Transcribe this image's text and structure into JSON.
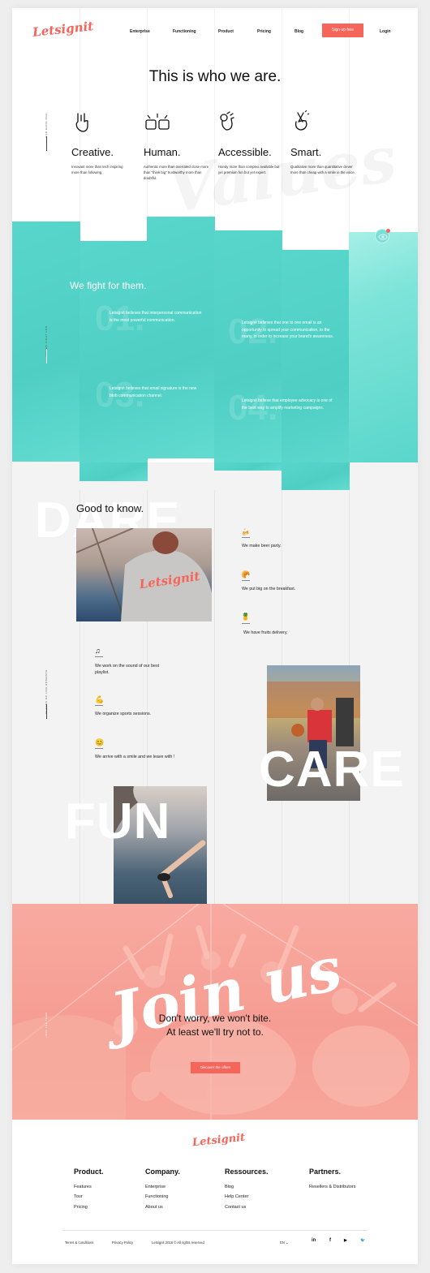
{
  "header": {
    "logo": "Letsignit",
    "nav": [
      "Enterprise",
      "Functioning",
      "Product",
      "Pricing",
      "Blog"
    ],
    "signup": "Sign up free",
    "login": "Login"
  },
  "values": {
    "title": "This is who we are.",
    "side_label": "OUR GANG DNA",
    "watermark": "Values",
    "items": [
      {
        "title": "Creative.",
        "desc": "Innovant more than tech inspiring more than following.",
        "icon": "rock-hand-icon"
      },
      {
        "title": "Human.",
        "desc": "Authentic more than overrated close more than \"think big\" trustworthy more than doubtful.",
        "icon": "fist-bump-icon"
      },
      {
        "title": "Accessible.",
        "desc": "Handy more than complex available but yet premium fun but yet expert.",
        "icon": "ok-hand-icon"
      },
      {
        "title": "Smart.",
        "desc": "Qualitative more than quantitative clever more than cheap with a smile in the voice.",
        "icon": "crossed-fingers-icon"
      }
    ]
  },
  "fight": {
    "title": "We fight for them.",
    "side_label": "AND WE FIGHT FOR",
    "items": [
      {
        "num": "01.",
        "text": "Letsignit believes that interpersonal communication is the most powerful communication."
      },
      {
        "num": "02.",
        "text": "Letsignit believes that one to one email is an opportunity to spread your communication, to the many, in order to increase your brand's awareness."
      },
      {
        "num": "03.",
        "text": "Letsignit believes that email signature is the new btob communication channel."
      },
      {
        "num": "04.",
        "text": "Letsignit believe that employee advocacy is one of the best way to amplify marketing campaigns."
      }
    ]
  },
  "know": {
    "title": "Good to know.",
    "side_label": "IN DANS DO LIKE ROMANCE",
    "words": [
      "DARE",
      "CARE",
      "FUN"
    ],
    "perks": [
      {
        "icon": "beer-icon",
        "glyph": "🍻",
        "text": "We make beer party."
      },
      {
        "icon": "croissant-icon",
        "glyph": "🥐",
        "text": "We put big on the breakfast."
      },
      {
        "icon": "pineapple-icon",
        "glyph": "🍍",
        "text": "We have fruits delivery."
      },
      {
        "icon": "music-note-icon",
        "glyph": "♫",
        "text": "We work on the sound of our best playlist."
      },
      {
        "icon": "flexed-biceps-icon",
        "glyph": "💪",
        "text": "We organize sports sessions."
      },
      {
        "icon": "smiley-icon",
        "glyph": "😊",
        "text": "We arrive with a smile and we leave with !"
      }
    ]
  },
  "join": {
    "script": "Join us",
    "side_label": "JOIN THE TEAM",
    "line1": "Don't worry, we won't bite.",
    "line2": "At least we'll try not to.",
    "button": "Discover the offers"
  },
  "footer": {
    "logo": "Letsignit",
    "columns": [
      {
        "title": "Product.",
        "links": [
          "Features",
          "Tour",
          "Pricing"
        ]
      },
      {
        "title": "Company.",
        "links": [
          "Enterprise",
          "Functioning",
          "About us"
        ]
      },
      {
        "title": "Ressources.",
        "links": [
          "Blog",
          "Help Center",
          "Contact us"
        ]
      },
      {
        "title": "Partners.",
        "links": [
          "Resellers & Distributors"
        ]
      }
    ],
    "terms": "Terms & conditions",
    "privacy": "Privacy Policy",
    "copyright": "Letsignit 2018 © All rights reserved",
    "lang": "EN",
    "social": [
      "in",
      "f",
      "▶",
      "🐦"
    ]
  },
  "colors": {
    "accent": "#f5655a",
    "teal": "#55d4c9",
    "salmon": "#f8a89e"
  }
}
